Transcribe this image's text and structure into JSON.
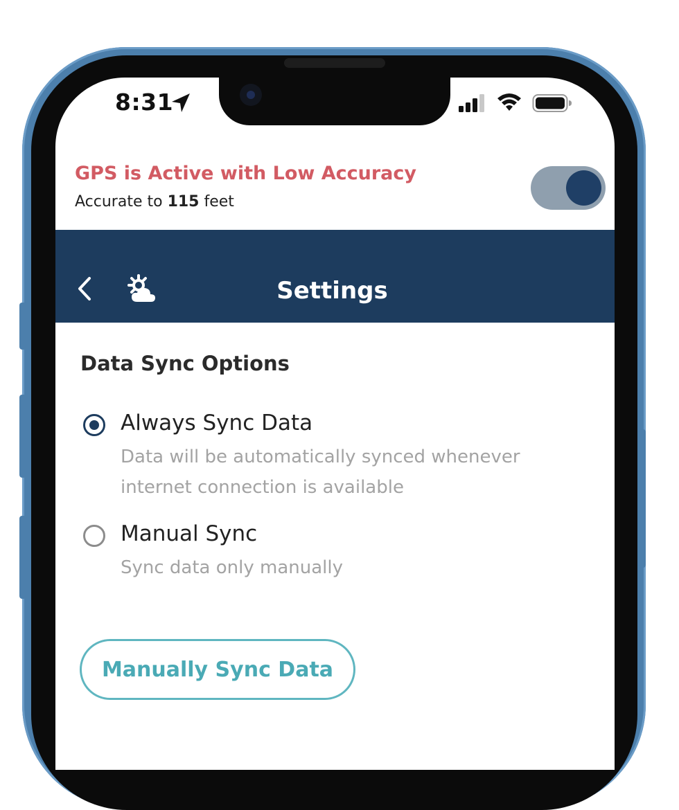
{
  "status_bar": {
    "time": "8:31",
    "icons": [
      "location-arrow-icon",
      "cellular-signal-icon",
      "wifi-icon",
      "battery-icon"
    ]
  },
  "gps_banner": {
    "title": "GPS is Active with Low Accuracy",
    "accuracy_prefix": "Accurate to ",
    "accuracy_value": "115",
    "accuracy_suffix": " feet",
    "toggle_on": true
  },
  "header": {
    "title": "Settings",
    "back_icon": "chevron-left-icon",
    "weather_icon": "cloud-sun-icon"
  },
  "data_sync": {
    "section_title": "Data Sync Options",
    "options": [
      {
        "label": "Always Sync Data",
        "description": "Data will be automatically synced whenever internet connection is available",
        "selected": true
      },
      {
        "label": "Manual Sync",
        "description": "Sync data only manually",
        "selected": false
      }
    ],
    "manual_sync_button": "Manually Sync Data"
  },
  "colors": {
    "header_bg": "#1d3c5e",
    "gps_warning": "#d25b63",
    "accent_teal": "#4aaab5",
    "phone_frame": "#4c7fac"
  }
}
